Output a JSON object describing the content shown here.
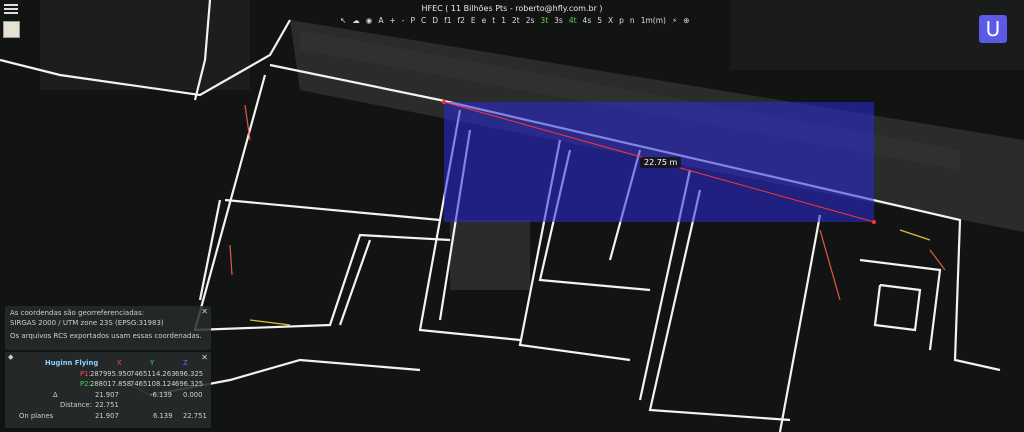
{
  "header": {
    "title": "HFEC ( 11 Bilhões Pts - roberto@hfly.com.br )"
  },
  "toolbar": {
    "items": [
      "↖",
      "☁",
      "◉",
      "A",
      "+",
      "-",
      "P",
      "C",
      "D",
      "f1",
      "f2",
      "E",
      "e",
      "t",
      "1",
      "2t",
      "2s",
      "3t",
      "3s",
      "4t",
      "4s",
      "5",
      "X",
      "p",
      "n",
      "1m(m)",
      "⚡",
      "⊕"
    ]
  },
  "logo": {
    "letter": "U",
    "color": "#5b5be8"
  },
  "measurement": {
    "label": "22.75 m"
  },
  "info_box": {
    "line1": "As coordendas são georreferenciadas:",
    "line2": "SIRGAS 2000 / UTM zone 23S (EPSG:31983)",
    "line3": "Os arquivos RCS exportados usam essas coordenadas.",
    "close": "✕"
  },
  "measure_panel": {
    "name": "Huginn Flying",
    "axis_x": "X",
    "axis_y": "Y",
    "axis_z": "Z",
    "p1_label": "P1:",
    "p1_x": "287995.950",
    "p1_y": "7465114.263",
    "p1_z": "696.325",
    "p2_label": "P2:",
    "p2_x": "288017.858",
    "p2_y": "7465108.124",
    "p2_z": "696.325",
    "delta_label": "Δ",
    "delta_x": "21.907",
    "delta_y": "-6.139",
    "delta_z": "0.000",
    "distance_label": "Distance:",
    "distance_value": "22.751",
    "onplanes_label": "On planes",
    "onplanes_x": "21.907",
    "onplanes_y": "6.139",
    "onplanes_z": "22.751",
    "close": "✕",
    "pin": "◆"
  },
  "colors": {
    "selection": "#2a2ad8",
    "axis_x": "#ff4444",
    "axis_y": "#44dd44",
    "axis_z": "#4477ff"
  }
}
